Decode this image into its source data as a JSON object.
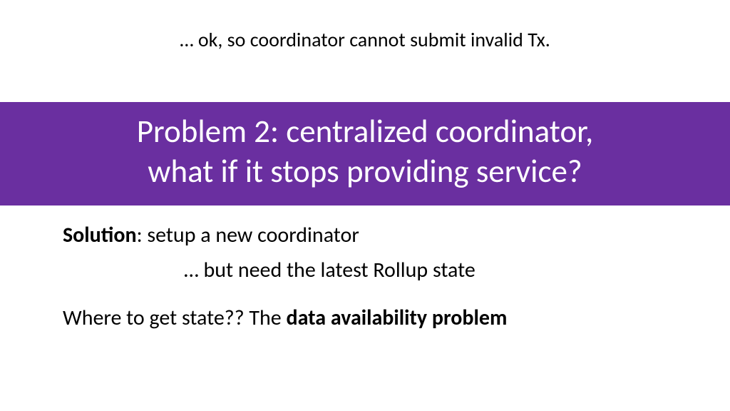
{
  "top": {
    "text": "… ok, so coordinator cannot submit invalid Tx."
  },
  "banner": {
    "line1": "Problem 2: centralized coordinator,",
    "line2": "what if it stops providing service?"
  },
  "body": {
    "solution_label": "Solution",
    "solution_text": ":  setup a new coordinator",
    "indent_text": "… but need the latest Rollup state",
    "where_prefix": "Where to get state??   The ",
    "where_bold": "data availability problem"
  }
}
